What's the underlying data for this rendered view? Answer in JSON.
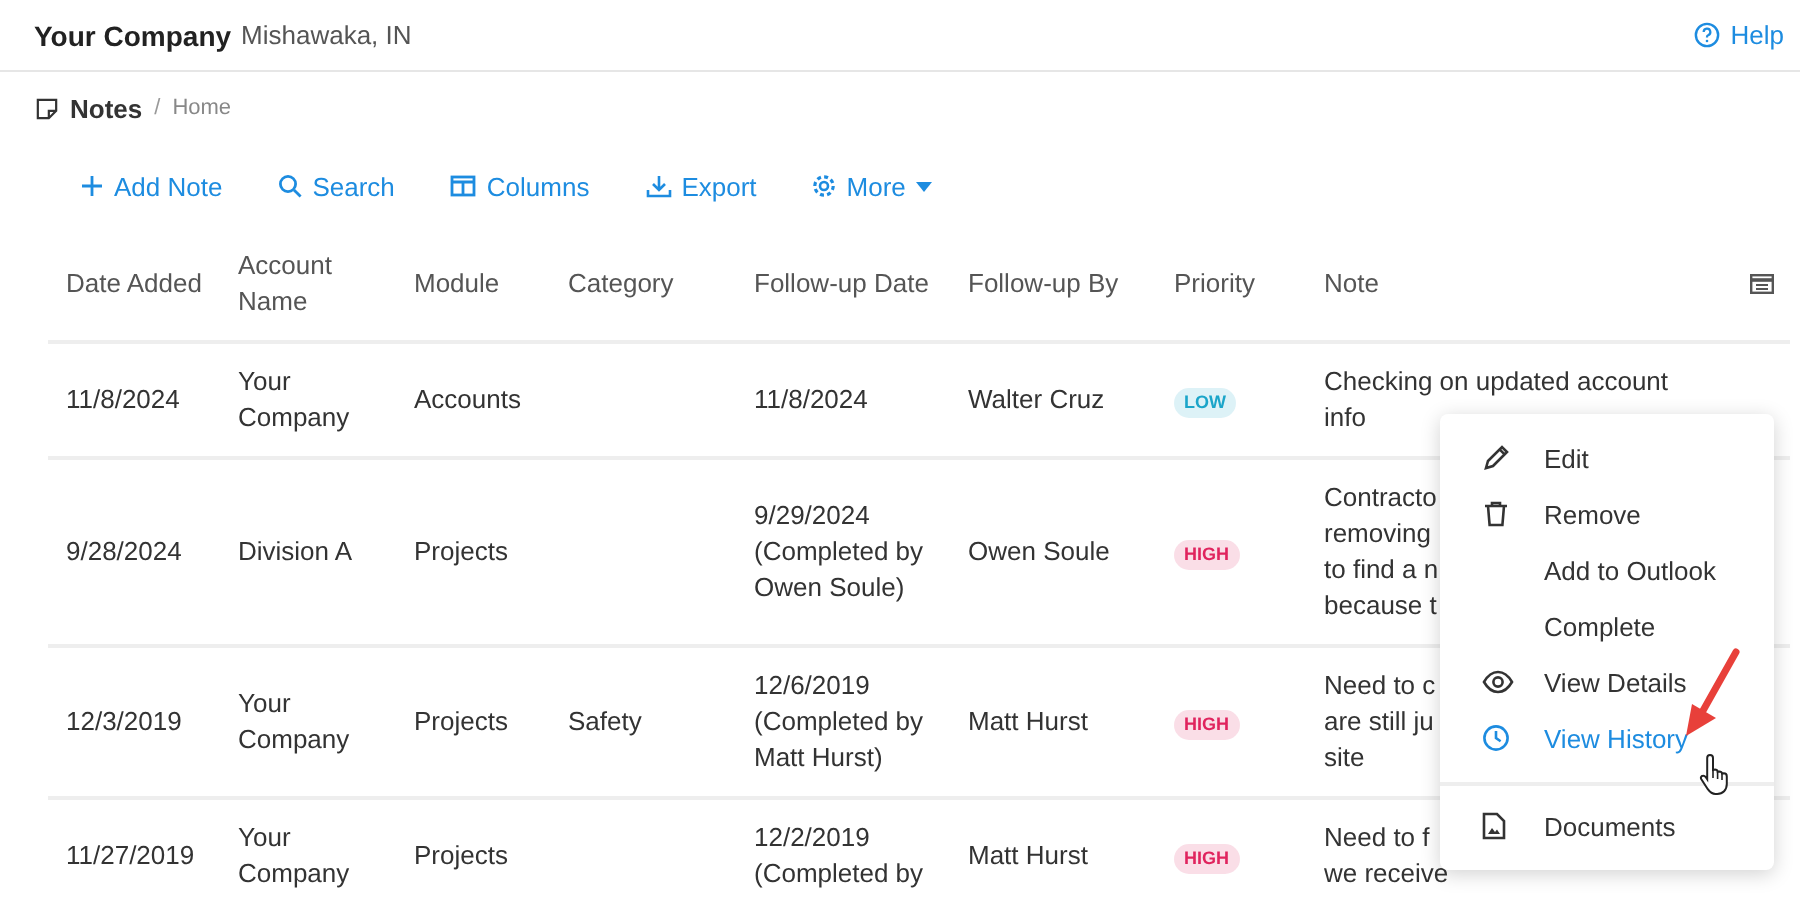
{
  "header": {
    "company": "Your Company",
    "location": "Mishawaka, IN",
    "help": "Help"
  },
  "breadcrumb": {
    "current": "Notes",
    "separator": "/",
    "parent": "Home"
  },
  "toolbar": [
    {
      "kind": "add",
      "label": "Add Note"
    },
    {
      "kind": "search",
      "label": "Search"
    },
    {
      "kind": "columns",
      "label": "Columns"
    },
    {
      "kind": "export",
      "label": "Export"
    },
    {
      "kind": "more",
      "label": "More"
    }
  ],
  "table": {
    "columns": [
      "Date Added",
      "Account Name",
      "Module",
      "Category",
      "Follow-up Date",
      "Follow-up By",
      "Priority",
      "Note"
    ],
    "rows": [
      {
        "date_added": "11/8/2024",
        "account": "Your Company",
        "module": "Accounts",
        "category": "",
        "followup_date": [
          "11/8/2024"
        ],
        "followup_by": "Walter Cruz",
        "priority": {
          "label": "LOW",
          "color": "#1ba5c9"
        },
        "note": [
          "Checking on updated account",
          "info"
        ]
      },
      {
        "date_added": "9/28/2024",
        "account": "Division A",
        "module": "Projects",
        "category": "",
        "followup_date": [
          "9/29/2024",
          "(Completed by",
          "Owen Soule)"
        ],
        "followup_by": "Owen Soule",
        "priority": {
          "label": "HIGH",
          "color": "#e0245e"
        },
        "note": [
          "Contracto",
          "removing",
          "to find a n",
          "because t"
        ]
      },
      {
        "date_added": "12/3/2019",
        "account": "Your Company",
        "module": "Projects",
        "category": "Safety",
        "followup_date": [
          "12/6/2019",
          "(Completed by",
          "Matt Hurst)"
        ],
        "followup_by": "Matt Hurst",
        "priority": {
          "label": "HIGH",
          "color": "#e0245e"
        },
        "note": [
          "Need to c",
          "are still ju",
          "site"
        ]
      },
      {
        "date_added": "11/27/2019",
        "account": "Your Company",
        "module": "Projects",
        "category": "",
        "followup_date": [
          "12/2/2019",
          "(Completed by"
        ],
        "followup_by": "Matt Hurst",
        "priority": {
          "label": "HIGH",
          "color": "#e0245e"
        },
        "note": [
          "Need to f",
          "we receive"
        ]
      }
    ]
  },
  "context_menu": [
    {
      "kind": "edit",
      "label": "Edit",
      "selected": false,
      "divider_before": false
    },
    {
      "kind": "remove",
      "label": "Remove",
      "selected": false,
      "divider_before": false
    },
    {
      "kind": "plain",
      "label": "Add to Outlook",
      "selected": false,
      "divider_before": false
    },
    {
      "kind": "plain",
      "label": "Complete",
      "selected": false,
      "divider_before": false
    },
    {
      "kind": "view",
      "label": "View Details",
      "selected": false,
      "divider_before": false
    },
    {
      "kind": "history",
      "label": "View History",
      "selected": true,
      "divider_before": false
    },
    {
      "kind": "document",
      "label": "Documents",
      "selected": false,
      "divider_before": true
    }
  ]
}
